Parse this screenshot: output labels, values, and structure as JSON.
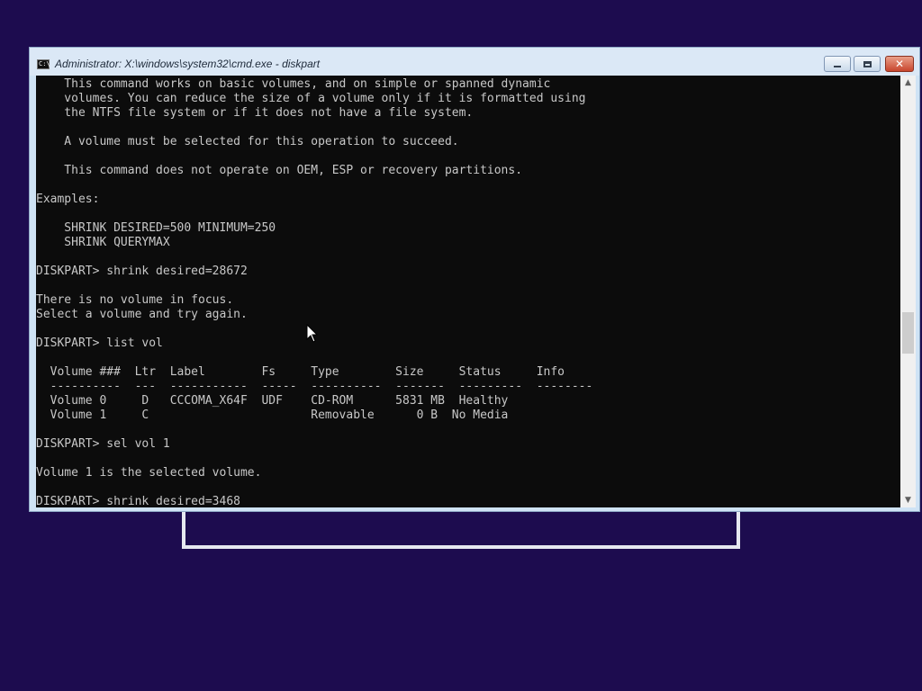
{
  "window": {
    "title": "Administrator: X:\\windows\\system32\\cmd.exe - diskpart",
    "icon": "cmd-icon",
    "icon_text": "C:\\",
    "buttons": {
      "minimize": "minimize-icon",
      "maximize": "maximize-icon",
      "close": "close-icon",
      "close_glyph": "✕"
    }
  },
  "console": {
    "lines": [
      "    This command works on basic volumes, and on simple or spanned dynamic",
      "    volumes. You can reduce the size of a volume only if it is formatted using",
      "    the NTFS file system or if it does not have a file system.",
      "",
      "    A volume must be selected for this operation to succeed.",
      "",
      "    This command does not operate on OEM, ESP or recovery partitions.",
      "",
      "Examples:",
      "",
      "    SHRINK DESIRED=500 MINIMUM=250",
      "    SHRINK QUERYMAX",
      "",
      "DISKPART> shrink desired=28672",
      "",
      "There is no volume in focus.",
      "Select a volume and try again.",
      "",
      "DISKPART> list vol",
      "",
      "  Volume ###  Ltr  Label        Fs     Type        Size     Status     Info",
      "  ----------  ---  -----------  -----  ----------  -------  ---------  --------",
      "  Volume 0     D   CCCOMA_X64F  UDF    CD-ROM      5831 MB  Healthy",
      "  Volume 1     C                       Removable      0 B  No Media",
      "",
      "DISKPART> sel vol 1",
      "",
      "Volume 1 is the selected volume.",
      "",
      "DISKPART> shrink desired=3468"
    ]
  },
  "scrollbar": {
    "up_glyph": "▲",
    "down_glyph": "▼"
  },
  "colors": {
    "console_bg": "#0c0c0c",
    "console_text": "#c8c8c8",
    "desktop": "#1d0c4f"
  }
}
